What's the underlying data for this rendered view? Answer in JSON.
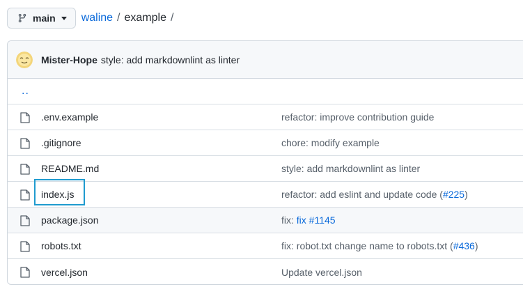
{
  "branch": {
    "name": "main"
  },
  "breadcrumb": {
    "repo": "waline",
    "sep1": "/",
    "dir": "example",
    "sep2": "/"
  },
  "commit": {
    "author": "Mister-Hope",
    "message": "style: add markdownlint as linter"
  },
  "updir": "..",
  "files": [
    {
      "name": ".env.example",
      "msg": "refactor: improve contribution guide"
    },
    {
      "name": ".gitignore",
      "msg": "chore: modify example"
    },
    {
      "name": "README.md",
      "msg": "style: add markdownlint as linter"
    },
    {
      "name": "index.js",
      "msg_pre": "refactor: add eslint and update code (",
      "link": "#225",
      "msg_post": ")"
    },
    {
      "name": "package.json",
      "msg_pre": "fix: ",
      "msg_link1": "fix",
      "msg_mid": " ",
      "link": "#1145"
    },
    {
      "name": "robots.txt",
      "msg_pre": "fix: robot.txt change name to robots.txt (",
      "link": "#436",
      "msg_post": ")"
    },
    {
      "name": "vercel.json",
      "msg": "Update vercel.json"
    }
  ],
  "colors": {
    "link": "#0969da",
    "text": "#24292f",
    "muted": "#57606a",
    "highlight": "#1f9bcf"
  }
}
